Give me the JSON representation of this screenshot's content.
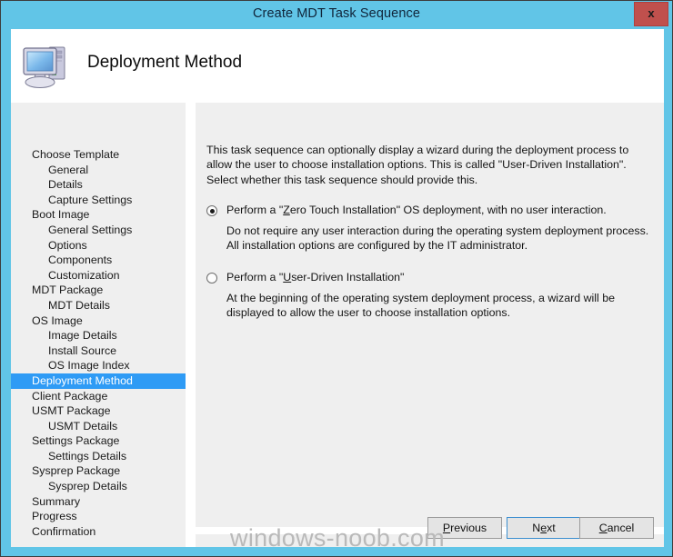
{
  "window": {
    "title": "Create MDT Task Sequence",
    "close_label": "x",
    "accent_blue": "#61c5e7",
    "close_red": "#c0504d"
  },
  "header": {
    "title": "Deployment Method",
    "icon": "computer-icon"
  },
  "sidebar": {
    "selected": "Deployment Method",
    "highlight_color": "#2f9bf5",
    "items": [
      {
        "label": "Choose Template",
        "level": 0
      },
      {
        "label": "General",
        "level": 1
      },
      {
        "label": "Details",
        "level": 1
      },
      {
        "label": "Capture Settings",
        "level": 1
      },
      {
        "label": "Boot Image",
        "level": 0
      },
      {
        "label": "General Settings",
        "level": 1
      },
      {
        "label": "Options",
        "level": 1
      },
      {
        "label": "Components",
        "level": 1
      },
      {
        "label": "Customization",
        "level": 1
      },
      {
        "label": "MDT Package",
        "level": 0
      },
      {
        "label": "MDT Details",
        "level": 1
      },
      {
        "label": "OS Image",
        "level": 0
      },
      {
        "label": "Image Details",
        "level": 1
      },
      {
        "label": "Install Source",
        "level": 1
      },
      {
        "label": "OS Image Index",
        "level": 1
      },
      {
        "label": "Deployment Method",
        "level": 0,
        "selected": true
      },
      {
        "label": "Client Package",
        "level": 0
      },
      {
        "label": "USMT Package",
        "level": 0
      },
      {
        "label": "USMT Details",
        "level": 1
      },
      {
        "label": "Settings Package",
        "level": 0
      },
      {
        "label": "Settings Details",
        "level": 1
      },
      {
        "label": "Sysprep Package",
        "level": 0
      },
      {
        "label": "Sysprep Details",
        "level": 1
      },
      {
        "label": "Summary",
        "level": 0
      },
      {
        "label": "Progress",
        "level": 0
      },
      {
        "label": "Confirmation",
        "level": 0
      }
    ]
  },
  "content": {
    "intro": "This task sequence can optionally display a wizard during the deployment process to allow the user to choose installation options.  This is called \"User-Driven Installation\".  Select whether this task sequence should provide this.",
    "options": [
      {
        "id": "zero-touch",
        "label_prefix": "Perform a \"",
        "label_accel": "Z",
        "label_suffix": "ero Touch Installation\" OS deployment, with no user interaction.",
        "label_full": "Perform a \"Zero Touch Installation\" OS deployment, with no user interaction.",
        "description": "Do not require any user interaction during the operating system deployment process.  All installation options are configured by the IT administrator.",
        "checked": true
      },
      {
        "id": "user-driven",
        "label_prefix": "Perform a \"",
        "label_accel": "U",
        "label_suffix": "ser-Driven Installation\"",
        "label_full": "Perform a \"User-Driven Installation\"",
        "description": "At the beginning of the operating system deployment process, a wizard will be displayed to allow the user to choose installation options.",
        "checked": false
      }
    ]
  },
  "footer": {
    "previous_prefix": "",
    "previous_accel": "P",
    "previous_suffix": "revious",
    "previous_label": "Previous",
    "next_prefix": "N",
    "next_accel": "e",
    "next_suffix": "xt",
    "next_label": "Next",
    "cancel_prefix": "",
    "cancel_accel": "C",
    "cancel_suffix": "ancel",
    "cancel_label": "Cancel"
  },
  "watermark": {
    "text": "windows-noob.com"
  }
}
